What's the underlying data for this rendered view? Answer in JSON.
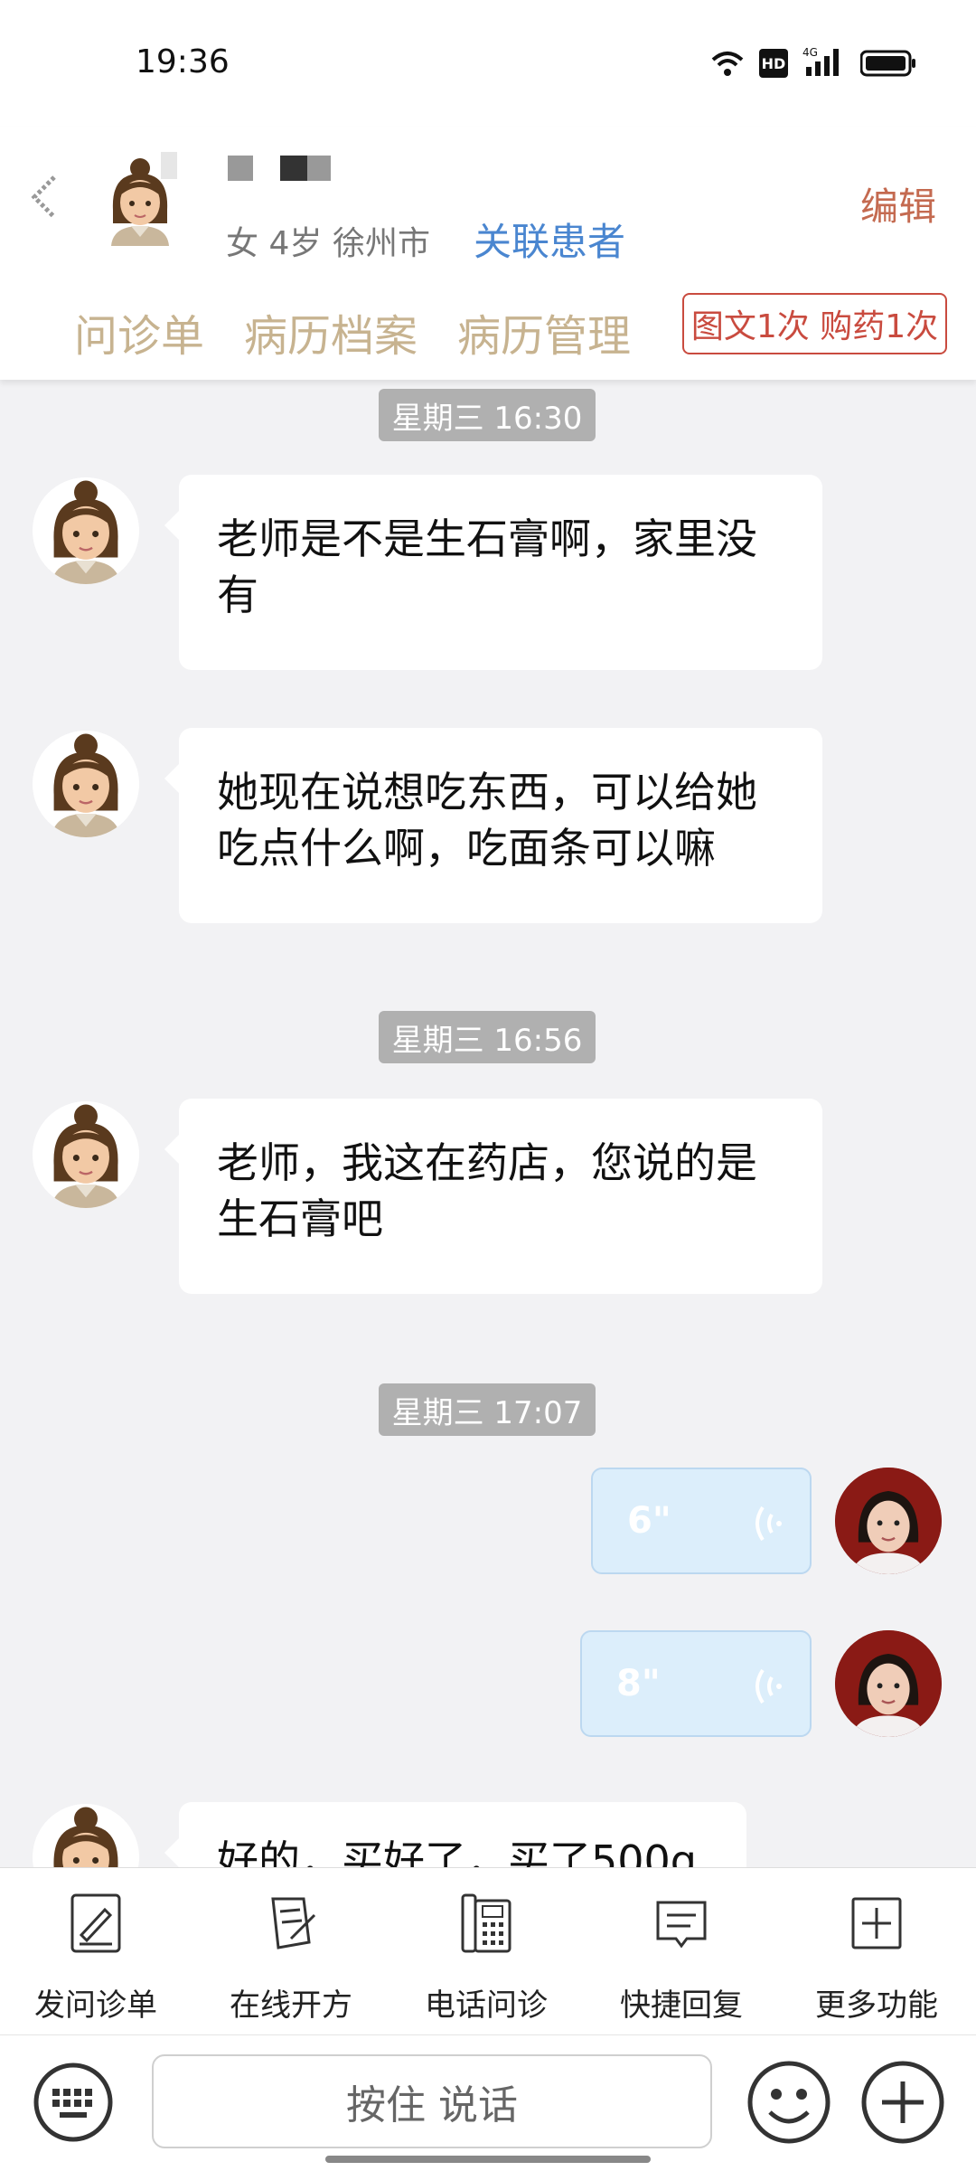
{
  "status_bar": {
    "time": "19:36",
    "icons": [
      "wifi-icon",
      "hd-icon",
      "4g-signal-icon",
      "battery-icon"
    ]
  },
  "header": {
    "gender_age": "女 4岁",
    "city": "徐州市",
    "link_patient": "关联患者",
    "edit": "编辑",
    "tabs": [
      "问诊单",
      "病历档案",
      "病历管理"
    ],
    "badge": "图文1次 购药1次"
  },
  "chat": {
    "timestamps": [
      "星期三 16:30",
      "星期三 16:56",
      "星期三 17:07"
    ],
    "messages": [
      {
        "from": "patient",
        "text": "老师是不是生石膏啊，家里没有"
      },
      {
        "from": "patient",
        "text": "她现在说想吃东西，可以给她吃点什么啊，吃面条可以嘛"
      },
      {
        "from": "patient",
        "text": "老师，我这在药店，您说的是生石膏吧"
      },
      {
        "from": "doctor",
        "voice_duration": "6\""
      },
      {
        "from": "doctor",
        "voice_duration": "8\""
      },
      {
        "from": "patient",
        "text": "好的，买好了，买了500g"
      }
    ]
  },
  "toolbar": {
    "items": [
      {
        "label": "发问诊单",
        "icon": "form-edit-icon"
      },
      {
        "label": "在线开方",
        "icon": "prescription-icon"
      },
      {
        "label": "电话问诊",
        "icon": "phone-icon"
      },
      {
        "label": "快捷回复",
        "icon": "quick-reply-icon"
      },
      {
        "label": "更多功能",
        "icon": "more-plus-icon"
      }
    ]
  },
  "input_bar": {
    "voice_button": "按住 说话",
    "left_icon": "keyboard-icon",
    "right_icons": [
      "emoji-icon",
      "plus-icon"
    ]
  },
  "colors": {
    "accent_blue": "#4a86d0",
    "tab_gold": "#c7b390",
    "badge_red": "#c94b3f",
    "edit": "#c46a50",
    "voice_bubble": "#dceefb"
  }
}
